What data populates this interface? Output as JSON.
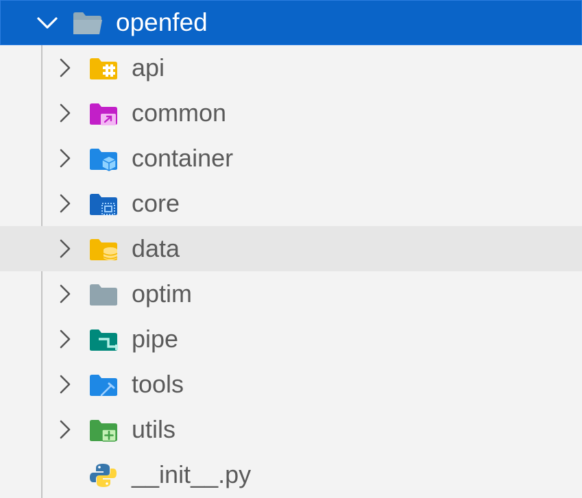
{
  "explorer": {
    "root": {
      "label": "openfed",
      "expanded": true,
      "icon": "folder-open-icon"
    },
    "items": [
      {
        "label": "api",
        "icon": "folder-api-icon",
        "color": "#f5b800"
      },
      {
        "label": "common",
        "icon": "folder-shared-icon",
        "color": "#c21fc8"
      },
      {
        "label": "container",
        "icon": "folder-container-icon",
        "color": "#1e88e5"
      },
      {
        "label": "core",
        "icon": "folder-core-icon",
        "color": "#1565c0"
      },
      {
        "label": "data",
        "icon": "folder-database-icon",
        "color": "#f5b800"
      },
      {
        "label": "optim",
        "icon": "folder-icon",
        "color": "#90a4ae"
      },
      {
        "label": "pipe",
        "icon": "folder-pipe-icon",
        "color": "#00897b"
      },
      {
        "label": "tools",
        "icon": "folder-tools-icon",
        "color": "#1e88e5"
      },
      {
        "label": "utils",
        "icon": "folder-utils-icon",
        "color": "#43a047"
      },
      {
        "label": "__init__.py",
        "icon": "python-file-icon",
        "color": "#3776ab"
      }
    ]
  },
  "colors": {
    "selection": "#0a64c8",
    "hover": "#e6e6e6",
    "background": "#f3f3f3",
    "text": "#5a5a5a"
  }
}
